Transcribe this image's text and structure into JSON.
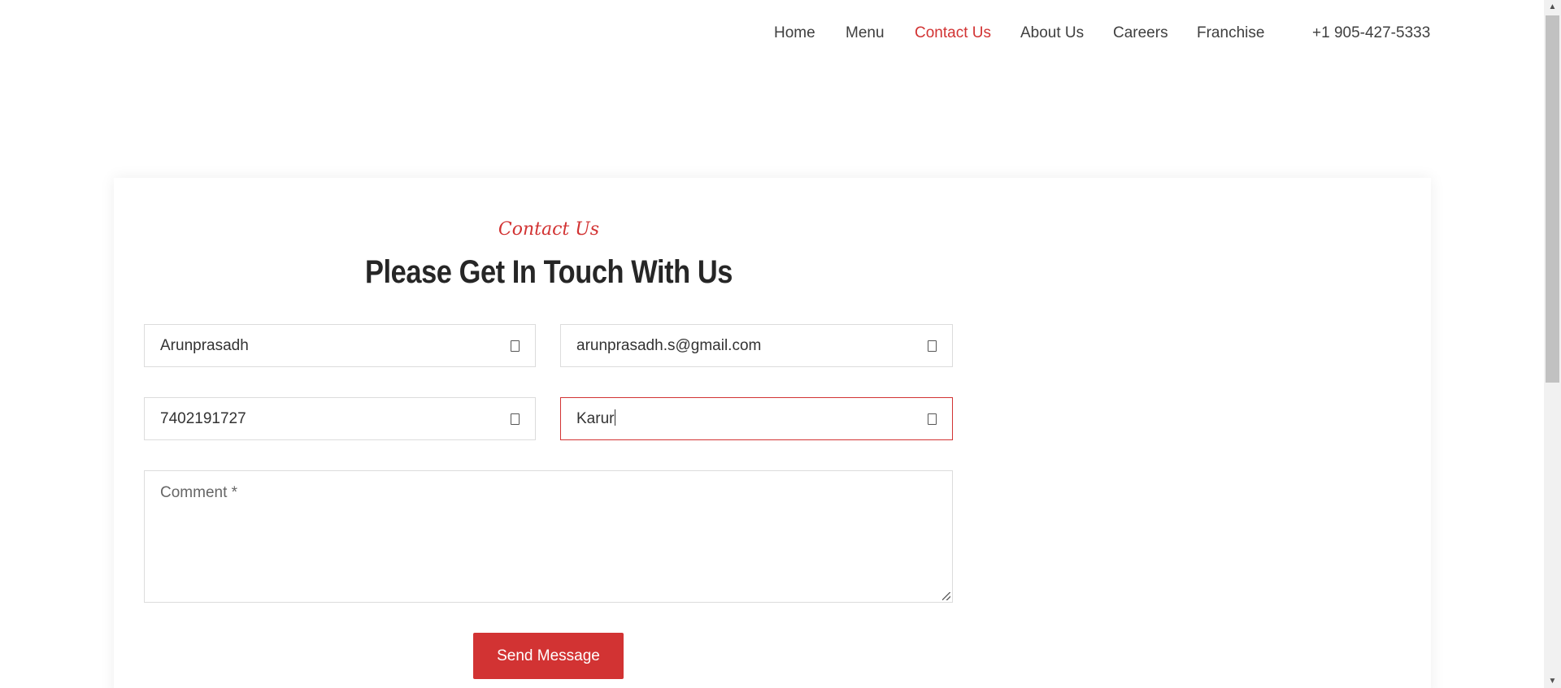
{
  "nav": {
    "home": "Home",
    "menu": "Menu",
    "contact": "Contact Us",
    "about": "About Us",
    "careers": "Careers",
    "franchise": "Franchise",
    "phone": "+1 905-427-5333"
  },
  "contact": {
    "eyebrow": "Contact Us",
    "heading": "Please Get In Touch With Us",
    "name_value": "Arunprasadh",
    "email_value": "arunprasadh.s@gmail.com",
    "phone_value": "7402191727",
    "city_value": "Karur",
    "comment_placeholder": "Comment *",
    "send_label": "Send Message"
  },
  "colors": {
    "accent": "#d23333",
    "text": "#333333",
    "border": "#dcdcdc"
  },
  "icons": {
    "field_icon": "input-icon"
  },
  "scrollbar": {
    "position_fraction": 0.0
  }
}
